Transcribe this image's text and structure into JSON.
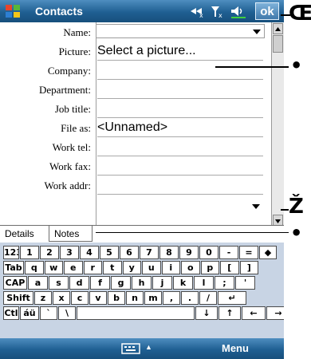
{
  "titlebar": {
    "title": "Contacts",
    "ok_label": "ok"
  },
  "form": {
    "fields": [
      {
        "label": "Name:",
        "value": ""
      },
      {
        "label": "Picture:",
        "value": "Select a picture..."
      },
      {
        "label": "Company:",
        "value": ""
      },
      {
        "label": "Department:",
        "value": ""
      },
      {
        "label": "Job title:",
        "value": ""
      },
      {
        "label": "File as:",
        "value": "<Unnamed>"
      },
      {
        "label": "Work tel:",
        "value": ""
      },
      {
        "label": "Work fax:",
        "value": ""
      },
      {
        "label": "Work addr:",
        "value": ""
      }
    ]
  },
  "tabs": [
    "Details",
    "Notes"
  ],
  "keyboard": {
    "row1": [
      "123",
      "1",
      "2",
      "3",
      "4",
      "5",
      "6",
      "7",
      "8",
      "9",
      "0",
      "-",
      "=",
      "◆"
    ],
    "row2": [
      "Tab",
      "q",
      "w",
      "e",
      "r",
      "t",
      "y",
      "u",
      "i",
      "o",
      "p",
      "[",
      "]"
    ],
    "row3": [
      "CAP",
      "a",
      "s",
      "d",
      "f",
      "g",
      "h",
      "j",
      "k",
      "l",
      ";",
      "'"
    ],
    "row4": [
      "Shift",
      "z",
      "x",
      "c",
      "v",
      "b",
      "n",
      "m",
      ",",
      ".",
      "/",
      "↵"
    ],
    "row5": [
      "Ctl",
      "áü",
      "`",
      "\\",
      "",
      "↓",
      "↑",
      "←",
      "→"
    ]
  },
  "bottombar": {
    "menu_label": "Menu"
  },
  "callouts": {
    "ok_marker": "Œ",
    "picture_marker": "•",
    "scroll_marker": "Ž",
    "tabs_marker": "•"
  },
  "colors": {
    "bar_blue": "#1f5f92",
    "keyboard_bg": "#c8d4e4"
  }
}
